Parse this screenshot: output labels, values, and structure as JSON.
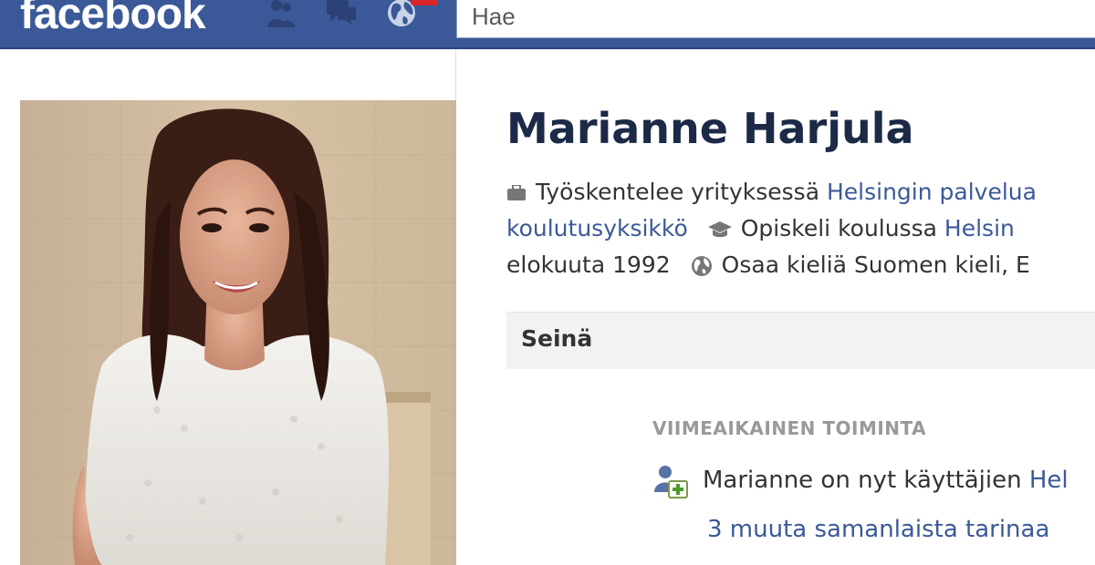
{
  "topbar": {
    "logo": "facebook",
    "search_placeholder": "Hae",
    "icons": [
      "friends-icon",
      "messages-icon",
      "notifications-icon"
    ],
    "colors": {
      "bar": "#3b5998",
      "badge": "#d8262a"
    }
  },
  "profile": {
    "name": "Marianne Harjula",
    "info": {
      "line1_prefix": "Työskentelee yrityksessä",
      "line1_link": "Helsingin palvelua",
      "line2_link": "koulutusyksikkö",
      "line2_prefix": "Opiskeli koulussa",
      "line2_school": "Helsin",
      "line3_date": "elokuuta 1992",
      "line3_prefix": "Osaa kieliä",
      "line3_languages": "Suomen kieli, E"
    }
  },
  "wall": {
    "tab_label": "Seinä",
    "recent_activity_heading": "VIIMEAIKAINEN TOIMINTA",
    "activity_prefix": "Marianne on nyt käyttäjien",
    "activity_link": "Hel",
    "more_stories": "3 muuta samanlaista tarinaa"
  },
  "colors": {
    "link": "#3b5998",
    "name": "#1c2a47",
    "muted": "#999999"
  }
}
